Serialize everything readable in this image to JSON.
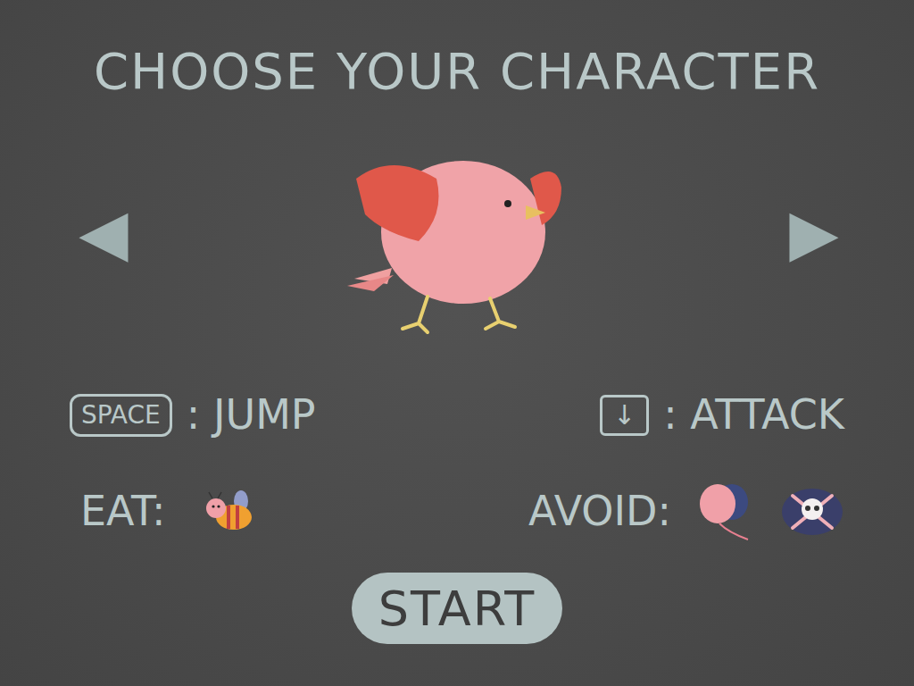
{
  "title": "CHOOSE YOUR CHARACTER",
  "nav": {
    "prev": "◀",
    "next": "▶"
  },
  "controls": [
    {
      "key": "SPACE",
      "label": ": JUMP"
    },
    {
      "key": "↓",
      "label": ": ATTACK"
    }
  ],
  "eat": {
    "label": "EAT:"
  },
  "avoid": {
    "label": "AVOID:"
  },
  "start": "START"
}
